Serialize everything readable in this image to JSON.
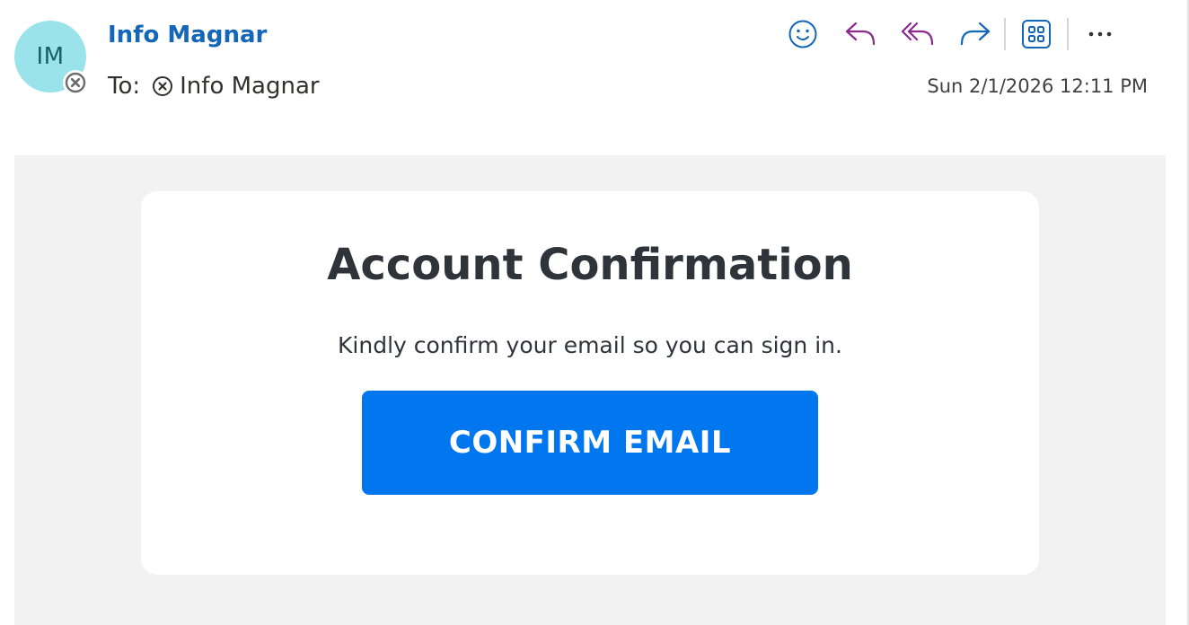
{
  "sender": {
    "initials": "IM",
    "name": "Info Magnar"
  },
  "recipients": {
    "label": "To:",
    "name": "Info Magnar"
  },
  "timestamp": "Sun 2/1/2026 12:11 PM",
  "toolbar": {
    "icons": [
      "smiley-icon",
      "reply-icon",
      "reply-all-icon",
      "forward-icon",
      "apps-icon",
      "more-icon"
    ]
  },
  "message": {
    "title": "Account Confirmation",
    "text": "Kindly confirm your email so you can sign in.",
    "button_label": "CONFIRM EMAIL"
  },
  "colors": {
    "sender_name": "#1366b8",
    "avatar_bg": "#9ae3ea",
    "reply_purple": "#8a2a8f",
    "toolbar_blue": "#1366b8",
    "button_bg": "#0077ee",
    "body_bg": "#f2f2f2"
  }
}
